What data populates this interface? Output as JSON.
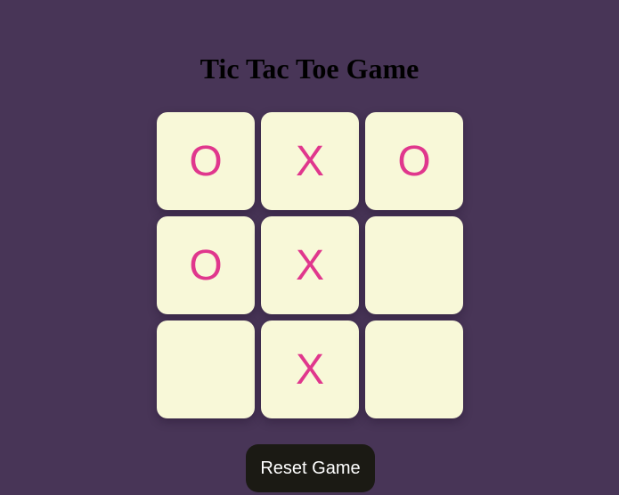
{
  "title": "Tic Tac Toe Game",
  "board": [
    [
      "O",
      "X",
      "O"
    ],
    [
      "O",
      "X",
      ""
    ],
    [
      "",
      "X",
      ""
    ]
  ],
  "reset_label": "Reset Game",
  "colors": {
    "background": "#483557",
    "cell": "#f8f8d8",
    "mark": "#e0378d",
    "button": "#1b1a14",
    "button_text": "#ffffff"
  }
}
